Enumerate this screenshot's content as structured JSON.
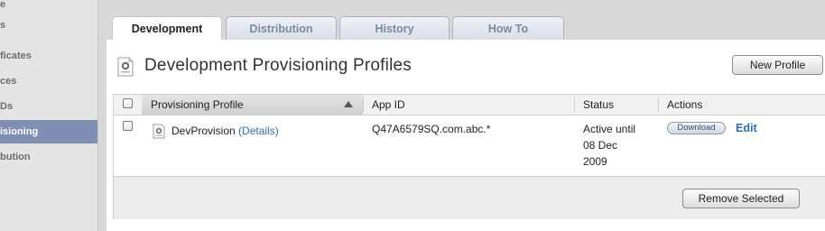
{
  "sidebar": {
    "items": [
      {
        "label": "e"
      },
      {
        "label": "s"
      },
      {
        "label": "ficates"
      },
      {
        "label": "ces"
      },
      {
        "label": "Ds"
      },
      {
        "label": "isioning"
      },
      {
        "label": "bution"
      }
    ],
    "active_index": 5
  },
  "tabs": [
    {
      "label": "Development"
    },
    {
      "label": "Distribution"
    },
    {
      "label": "History"
    },
    {
      "label": "How To"
    }
  ],
  "page": {
    "title": "Development Provisioning Profiles",
    "new_profile_label": "New Profile"
  },
  "table": {
    "headers": {
      "profile": "Provisioning Profile",
      "app_id": "App ID",
      "status": "Status",
      "actions": "Actions"
    },
    "sort_icon": "sort-ascending-icon",
    "rows": [
      {
        "name": "DevProvision",
        "details_label": "(Details)",
        "app_id": "Q47A6579SQ.com.abc.*",
        "status_line1": "Active until",
        "status_line2": "08 Dec",
        "status_line3": "2009",
        "download_label": "Download",
        "edit_label": "Edit"
      }
    ],
    "remove_selected_label": "Remove Selected"
  },
  "colors": {
    "sidebar_active": "#7f8fb3",
    "link": "#2a6ebb",
    "tab_inactive_text": "#7c8aa0"
  }
}
